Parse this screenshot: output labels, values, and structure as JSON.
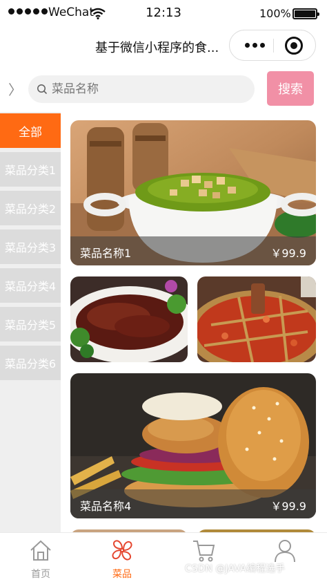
{
  "status_bar": {
    "carrier": "WeChat",
    "time": "12:13",
    "battery": "100%"
  },
  "nav": {
    "title": "基于微信小程序的食..."
  },
  "search": {
    "back": "〉",
    "placeholder": "菜品名称",
    "button": "搜索"
  },
  "categories": [
    {
      "label": "全部",
      "active": true
    },
    {
      "label": "菜品分类1"
    },
    {
      "label": "菜品分类2"
    },
    {
      "label": "菜品分类3"
    },
    {
      "label": "菜品分类4"
    },
    {
      "label": "菜品分类5"
    },
    {
      "label": "菜品分类6"
    }
  ],
  "dishes": [
    {
      "name": "菜品名称1",
      "price": "￥99.9",
      "image": "soup-bowl-photo"
    },
    {
      "image": "braised-meat-photo"
    },
    {
      "image": "hotpot-photo"
    },
    {
      "name": "菜品名称4",
      "price": "￥99.9",
      "image": "burger-photo"
    }
  ],
  "tabs": [
    {
      "label": "首页",
      "icon": "home-icon"
    },
    {
      "label": "菜品",
      "icon": "clover-icon",
      "active": true
    },
    {
      "label": "",
      "icon": "cart-icon"
    },
    {
      "label": "",
      "icon": "user-icon"
    }
  ],
  "watermark": "CSDN @JAVA编程选手",
  "colors": {
    "accent": "#ff6a13",
    "search_button": "#f190a6",
    "inactive_category": "#dcdcdc"
  }
}
